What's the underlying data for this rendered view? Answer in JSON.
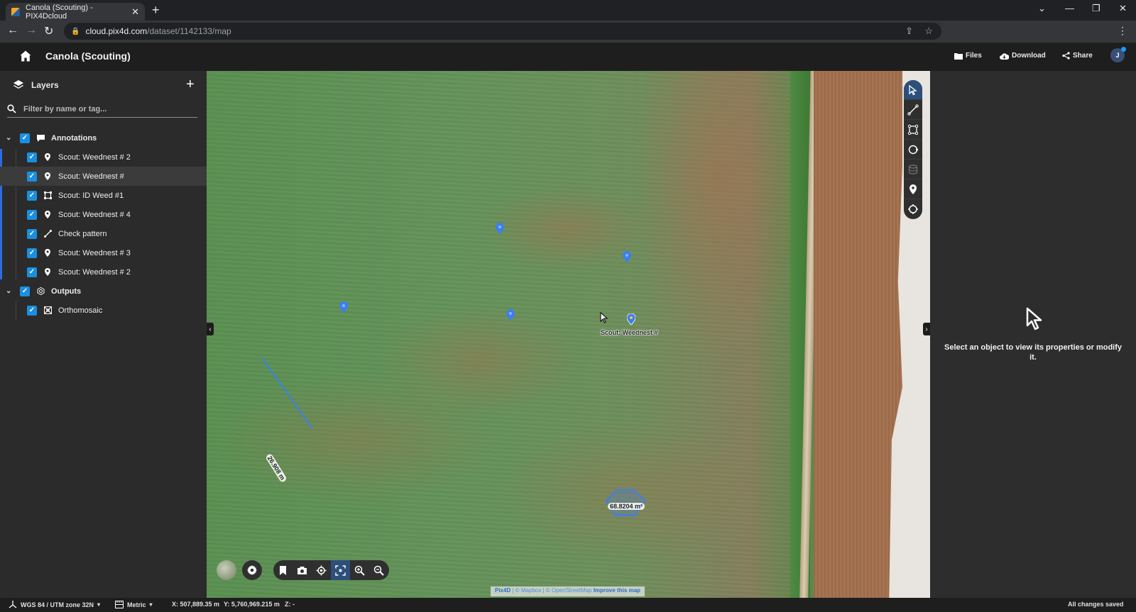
{
  "browser": {
    "tab_title": "Canola (Scouting) - PIX4Dcloud",
    "url_host": "cloud.pix4d.com",
    "url_path": "/dataset/1142133/map"
  },
  "header": {
    "title": "Canola (Scouting)",
    "files_label": "Files",
    "download_label": "Download",
    "share_label": "Share",
    "avatar_initial": "J"
  },
  "sidebar": {
    "title": "Layers",
    "filter_placeholder": "Filter by name or tag...",
    "groups": [
      {
        "label": "Annotations",
        "checked": true,
        "items": [
          {
            "label": "Scout: Weednest # 2",
            "icon": "pin-icon",
            "checked": true
          },
          {
            "label": "Scout: Weednest #",
            "icon": "pin-icon",
            "checked": true,
            "selected": true
          },
          {
            "label": "Scout: ID Weed #1",
            "icon": "polygon-icon",
            "checked": true
          },
          {
            "label": "Scout: Weednest # 4",
            "icon": "pin-icon",
            "checked": true
          },
          {
            "label": "Check pattern",
            "icon": "polyline-icon",
            "checked": true
          },
          {
            "label": "Scout: Weednest # 3",
            "icon": "pin-icon",
            "checked": true
          },
          {
            "label": "Scout: Weednest # 2",
            "icon": "pin-icon",
            "checked": true
          }
        ]
      },
      {
        "label": "Outputs",
        "checked": true,
        "items": [
          {
            "label": "Orthomosaic",
            "icon": "orthomosaic-icon",
            "checked": true
          }
        ]
      }
    ]
  },
  "map": {
    "pin_label": "Scout: Weednest #",
    "area_label": "68.8204 m²",
    "length_label": "26.908 m",
    "attribution": {
      "pix4d": "Pix4D",
      "mapbox": "© Mapbox",
      "osm": "© OpenStreetMap",
      "improve": "Improve this map"
    },
    "annotation_color": "#3d7ff0"
  },
  "tools": [
    "select",
    "polyline",
    "polygon",
    "circle",
    "volume",
    "marker",
    "point"
  ],
  "map_buttons": [
    "basemap",
    "settings",
    "bookmark",
    "screenshot",
    "locate",
    "fit-view",
    "zoom-in",
    "zoom-out"
  ],
  "right_panel": {
    "empty_message": "Select an object to view its properties or modify it."
  },
  "status": {
    "crs": "WGS 84 / UTM zone 32N",
    "units": "Metric",
    "x": "X: 507,889.35 m",
    "y": "Y: 5,760,969.215 m",
    "z": "Z: -",
    "save_state": "All changes saved"
  }
}
